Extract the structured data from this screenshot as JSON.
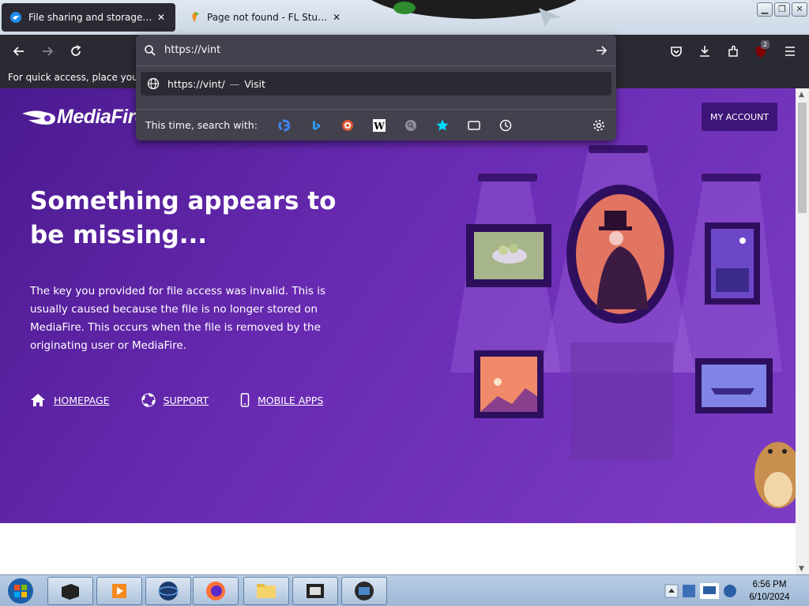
{
  "tabs": [
    {
      "title": "File sharing and storage made simple",
      "close": "✕",
      "active": true
    },
    {
      "title": "Page not found - FL Studio",
      "close": "✕",
      "active": false
    }
  ],
  "url_bar": {
    "value": "https://vint",
    "suggestion_url": "https://vint/",
    "suggestion_sep": "—",
    "suggestion_action": "Visit",
    "search_with_label": "This time, search with:",
    "engines": [
      "Google",
      "Bing",
      "DuckDuckGo",
      "Wikipedia",
      "Search",
      "Bookmarks",
      "Tabs",
      "History"
    ]
  },
  "bookmarks_bar": {
    "text": "For quick access, place your bookmarks here on the bookmarks toolbar."
  },
  "extension_badge": "2",
  "page": {
    "logo_text": "MediaFire",
    "my_account": "MY ACCOUNT",
    "heading": "Something appears to be missing...",
    "body": "The key you provided for file access was invalid. This is usually caused because the file is no longer stored on MediaFire. This occurs when the file is removed by the originating user or MediaFire.",
    "links": [
      {
        "label": "HOMEPAGE",
        "icon": "home-icon"
      },
      {
        "label": "SUPPORT",
        "icon": "lifebuoy-icon"
      },
      {
        "label": "MOBILE APPS",
        "icon": "phone-icon"
      }
    ]
  },
  "taskbar": {
    "time": "6:56 PM",
    "date": "6/10/2024"
  },
  "colors": {
    "browser_dark": "#2b2a33",
    "panel": "#42414d",
    "page_purple": "#6a2bb4",
    "account_button": "#3d1578"
  }
}
